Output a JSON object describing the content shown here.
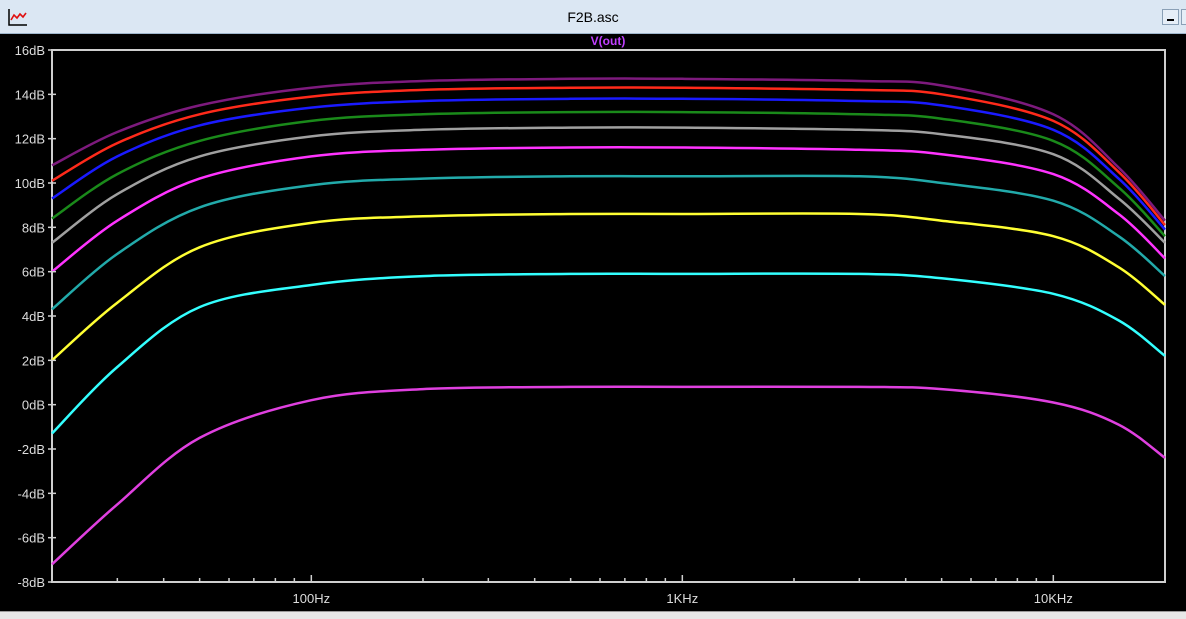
{
  "window": {
    "title": "F2B.asc"
  },
  "chart_data": {
    "type": "line",
    "title": "V(out)",
    "title_color": "#c040ff",
    "x_scale": "log",
    "xlim": [
      20,
      20000
    ],
    "ylim": [
      -8,
      16
    ],
    "x_ticks": [
      {
        "value": 100,
        "label": "100Hz"
      },
      {
        "value": 1000,
        "label": "1KHz"
      },
      {
        "value": 10000,
        "label": "10KHz"
      }
    ],
    "y_ticks": [
      {
        "value": 16,
        "label": "16dB"
      },
      {
        "value": 14,
        "label": "14dB"
      },
      {
        "value": 12,
        "label": "12dB"
      },
      {
        "value": 10,
        "label": "10dB"
      },
      {
        "value": 8,
        "label": "8dB"
      },
      {
        "value": 6,
        "label": "6dB"
      },
      {
        "value": 4,
        "label": "4dB"
      },
      {
        "value": 2,
        "label": "2dB"
      },
      {
        "value": 0,
        "label": "0dB"
      },
      {
        "value": -2,
        "label": "-2dB"
      },
      {
        "value": -4,
        "label": "-4dB"
      },
      {
        "value": -6,
        "label": "-6dB"
      },
      {
        "value": -8,
        "label": "-8dB"
      }
    ],
    "grid": false,
    "x": [
      20,
      30,
      50,
      100,
      200,
      500,
      1000,
      3000,
      5000,
      10000,
      15000,
      20000
    ],
    "series": [
      {
        "color": "#7d1a7d",
        "values": [
          10.8,
          12.3,
          13.5,
          14.3,
          14.6,
          14.7,
          14.7,
          14.6,
          14.4,
          13.1,
          10.7,
          8.3
        ]
      },
      {
        "color": "#ff2a1a",
        "values": [
          10.1,
          11.8,
          13.1,
          13.9,
          14.2,
          14.3,
          14.3,
          14.2,
          14.0,
          12.8,
          10.5,
          8.1
        ]
      },
      {
        "color": "#1a1aff",
        "values": [
          9.3,
          11.2,
          12.6,
          13.4,
          13.7,
          13.8,
          13.8,
          13.7,
          13.5,
          12.4,
          10.2,
          7.9
        ]
      },
      {
        "color": "#1a8a1a",
        "values": [
          8.4,
          10.4,
          11.9,
          12.8,
          13.1,
          13.2,
          13.2,
          13.1,
          12.9,
          11.9,
          9.8,
          7.6
        ]
      },
      {
        "color": "#a0a0a0",
        "values": [
          7.3,
          9.5,
          11.2,
          12.1,
          12.4,
          12.5,
          12.5,
          12.4,
          12.2,
          11.3,
          9.3,
          7.3
        ]
      },
      {
        "color": "#ff33ff",
        "values": [
          6.0,
          8.3,
          10.2,
          11.2,
          11.5,
          11.6,
          11.6,
          11.5,
          11.3,
          10.4,
          8.6,
          6.6
        ]
      },
      {
        "color": "#22aaaa",
        "values": [
          4.3,
          6.8,
          8.9,
          9.9,
          10.2,
          10.3,
          10.3,
          10.3,
          10.0,
          9.2,
          7.6,
          5.8
        ]
      },
      {
        "color": "#ffff33",
        "values": [
          2.0,
          4.6,
          7.1,
          8.2,
          8.5,
          8.6,
          8.6,
          8.6,
          8.3,
          7.6,
          6.2,
          4.5
        ]
      },
      {
        "color": "#33ffff",
        "values": [
          -1.3,
          1.7,
          4.4,
          5.4,
          5.8,
          5.9,
          5.9,
          5.9,
          5.7,
          5.0,
          3.8,
          2.2
        ]
      },
      {
        "color": "#e040e0",
        "values": [
          -7.2,
          -4.5,
          -1.5,
          0.2,
          0.7,
          0.8,
          0.8,
          0.8,
          0.7,
          0.1,
          -0.9,
          -2.4
        ]
      }
    ]
  }
}
